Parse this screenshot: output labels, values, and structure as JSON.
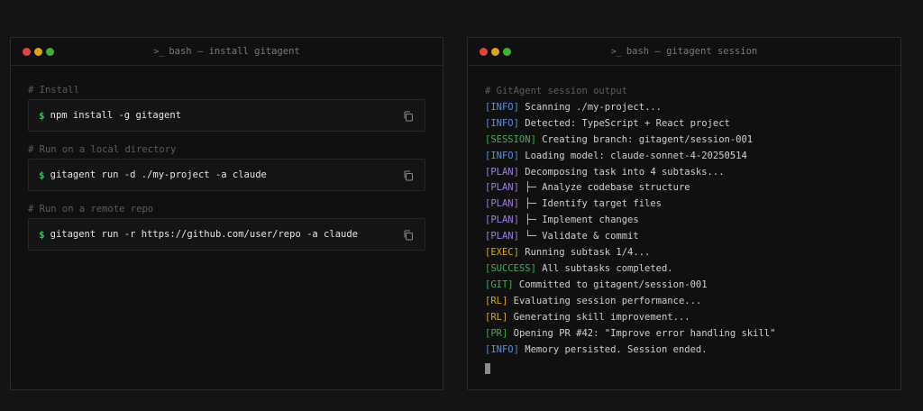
{
  "left_window": {
    "title": "bash — install gitagent",
    "title_icon": ">_",
    "commands": [
      {
        "comment": "# Install",
        "prompt": "$",
        "command": "npm install -g gitagent"
      },
      {
        "comment": "# Run on a local directory",
        "prompt": "$",
        "command": "gitagent run -d ./my-project -a claude"
      },
      {
        "comment": "# Run on a remote repo",
        "prompt": "$",
        "command": "gitagent run -r https://github.com/user/repo -a claude"
      }
    ]
  },
  "right_window": {
    "title": "bash — gitagent session",
    "title_icon": ">_",
    "comment": "# GitAgent session output",
    "lines": [
      {
        "tag": "[INFO]",
        "color": "#5b8fd9",
        "text": " Scanning ./my-project..."
      },
      {
        "tag": "[INFO]",
        "color": "#5b8fd9",
        "text": " Detected: TypeScript + React project"
      },
      {
        "tag": "[SESSION]",
        "color": "#3fae5a",
        "text": " Creating branch: gitagent/session-001"
      },
      {
        "tag": "[INFO]",
        "color": "#5b8fd9",
        "text": " Loading model: claude-sonnet-4-20250514"
      },
      {
        "tag": "[PLAN]",
        "color": "#9d7fe0",
        "text": " Decomposing task into 4 subtasks..."
      },
      {
        "tag": "[PLAN]",
        "color": "#9d7fe0",
        "text": " ├─ Analyze codebase structure"
      },
      {
        "tag": "[PLAN]",
        "color": "#9d7fe0",
        "text": " ├─ Identify target files"
      },
      {
        "tag": "[PLAN]",
        "color": "#9d7fe0",
        "text": " ├─ Implement changes"
      },
      {
        "tag": "[PLAN]",
        "color": "#9d7fe0",
        "text": " └─ Validate & commit"
      },
      {
        "tag": "[EXEC]",
        "color": "#d9a520",
        "text": " Running subtask 1/4..."
      },
      {
        "tag": "[SUCCESS]",
        "color": "#3fae5a",
        "text": " All subtasks completed."
      },
      {
        "tag": "[GIT]",
        "color": "#3fae5a",
        "text": " Committed to gitagent/session-001"
      },
      {
        "tag": "[RL]",
        "color": "#d9a520",
        "text": " Evaluating session performance..."
      },
      {
        "tag": "[RL]",
        "color": "#d9a520",
        "text": " Generating skill improvement..."
      },
      {
        "tag": "[PR]",
        "color": "#3fae5a",
        "text": " Opening PR #42: \"Improve error handling skill\""
      },
      {
        "tag": "[INFO]",
        "color": "#5b8fd9",
        "text": " Memory persisted. Session ended."
      }
    ]
  },
  "icons": {
    "terminal": "terminal-icon",
    "copy": "copy-icon"
  }
}
